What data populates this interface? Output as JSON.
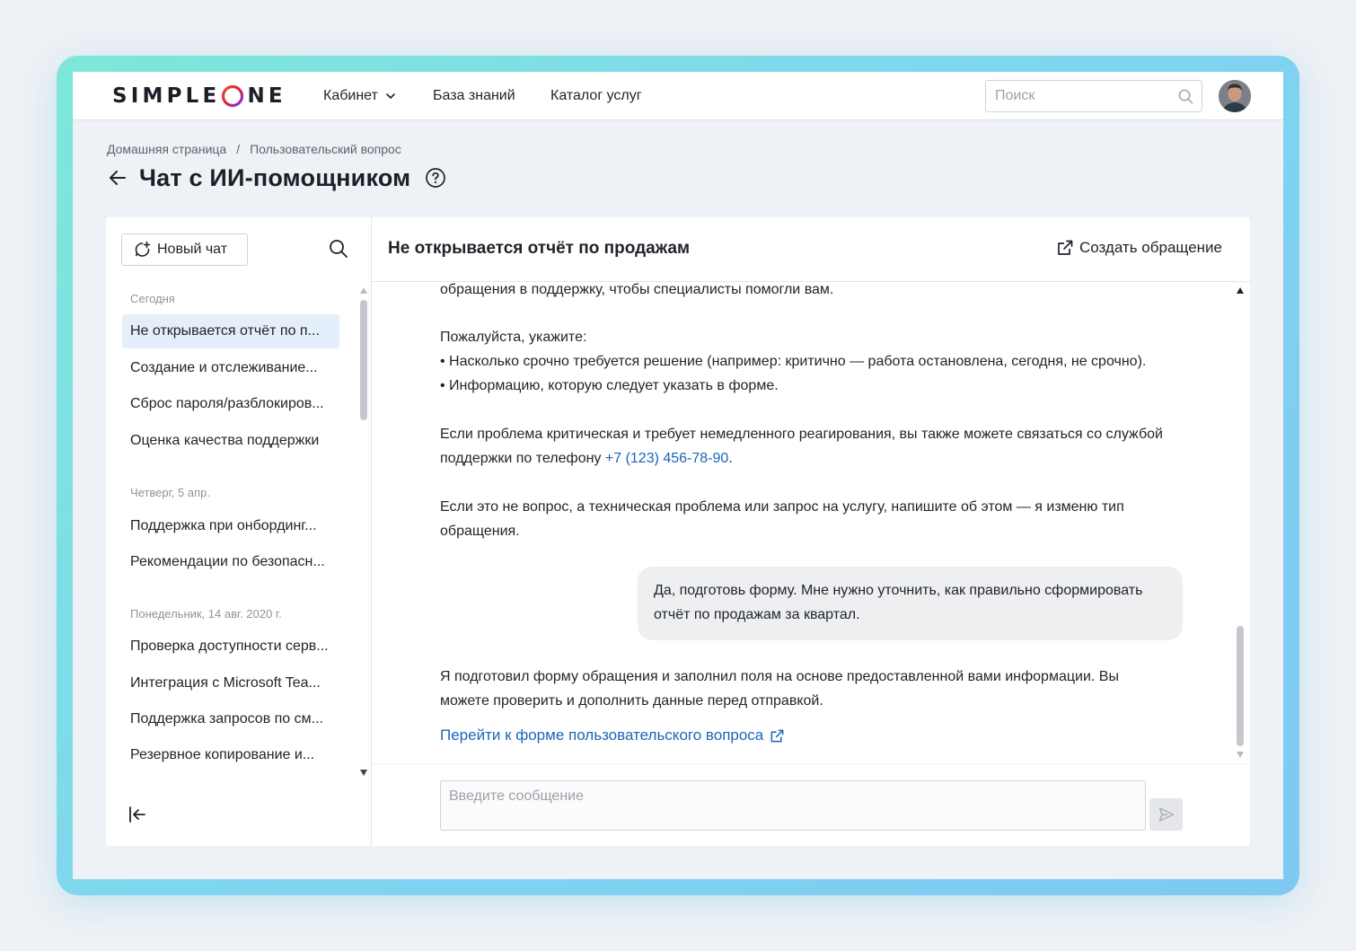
{
  "header": {
    "logo_text_left": "SIMPLE",
    "logo_text_right": "NE",
    "nav": {
      "cabinet": "Кабинет",
      "knowledge_base": "База знаний",
      "catalog": "Каталог услуг"
    },
    "search": {
      "placeholder": "Поиск",
      "value": ""
    },
    "avatar_icon": "user-avatar"
  },
  "breadcrumb": {
    "home": "Домашняя страница",
    "separator": "/",
    "current": "Пользовательский вопрос"
  },
  "page": {
    "title": "Чат с ИИ-помощником"
  },
  "sidebar": {
    "new_chat_label": "Новый чат",
    "groups": [
      {
        "label": "Сегодня",
        "items": [
          {
            "label": "Не открывается отчёт по п...",
            "active": true
          },
          {
            "label": "Создание и отслеживание..."
          },
          {
            "label": "Сброс пароля/разблокиров..."
          },
          {
            "label": "Оценка качества поддержки"
          }
        ]
      },
      {
        "label": "Четверг, 5 апр.",
        "items": [
          {
            "label": "Поддержка при онбординг..."
          },
          {
            "label": "Рекомендации по безопасн..."
          }
        ]
      },
      {
        "label": "Понедельник, 14 авг. 2020 г.",
        "items": [
          {
            "label": "Проверка доступности серв..."
          },
          {
            "label": "Интеграция с Microsoft Tea..."
          },
          {
            "label": "Поддержка запросов по см..."
          },
          {
            "label": "Резервное копирование и..."
          }
        ]
      }
    ]
  },
  "chat": {
    "title": "Не открывается отчёт по продажам",
    "create_ticket_label": "Создать обращение",
    "messages": {
      "line1": "обращения в поддержку, чтобы специалисты помогли вам.",
      "line2": "Пожалуйста, укажите:",
      "line3": "• Насколько срочно требуется решение (например: критично — работа остановлена, сегодня, не срочно).",
      "line4": "• Информацию, которую следует указать в форме.",
      "line5": "Если проблема критическая и требует немедленного реагирования, вы также можете связаться со службой",
      "line6_prefix": "поддержки по телефону ",
      "phone": "+7 (123) 456-78-90",
      "line6_suffix": ".",
      "line7": "Если это не вопрос, а техническая проблема или запрос на услугу, напишите об этом — я изменю тип",
      "line8": "обращения.",
      "user_line1": "Да, подготовь форму. Мне нужно уточнить, как правильно сформировать",
      "user_line2": "отчёт по продажам за квартал.",
      "line9": "Я подготовил форму обращения и заполнил поля на основе предоставленной вами информации. Вы",
      "line10": "можете проверить и дополнить данные перед отправкой.",
      "form_link": "Перейти к форме пользовательского вопроса"
    },
    "composer": {
      "placeholder": "Введите сообщение",
      "value": ""
    }
  },
  "colors": {
    "accent_link": "#1a66b8",
    "active_item_bg": "#e5eefb",
    "frame_gradient_start": "#7de8d8",
    "frame_gradient_end": "#7fc9f3",
    "logo_ring_start": "#d7263d",
    "logo_ring_end": "#7b2ff7"
  }
}
